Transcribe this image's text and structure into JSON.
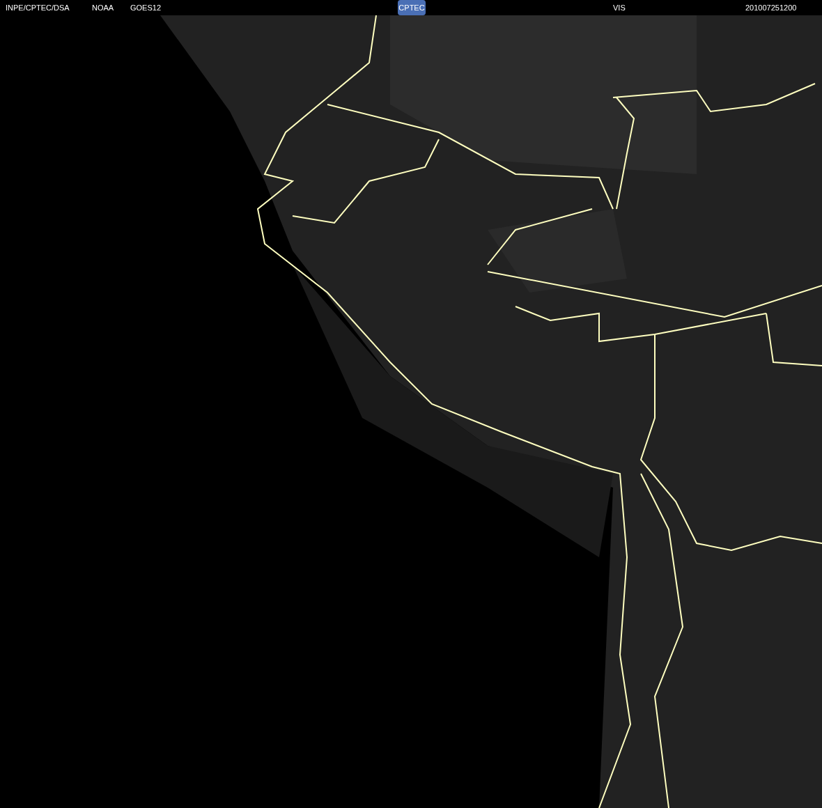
{
  "header": {
    "source": "INPE/CPTEC/DSA",
    "agency": "NOAA",
    "satellite": "GOES12",
    "logo": "CPTEC",
    "channel": "VIS",
    "timestamp": "201007251200"
  }
}
